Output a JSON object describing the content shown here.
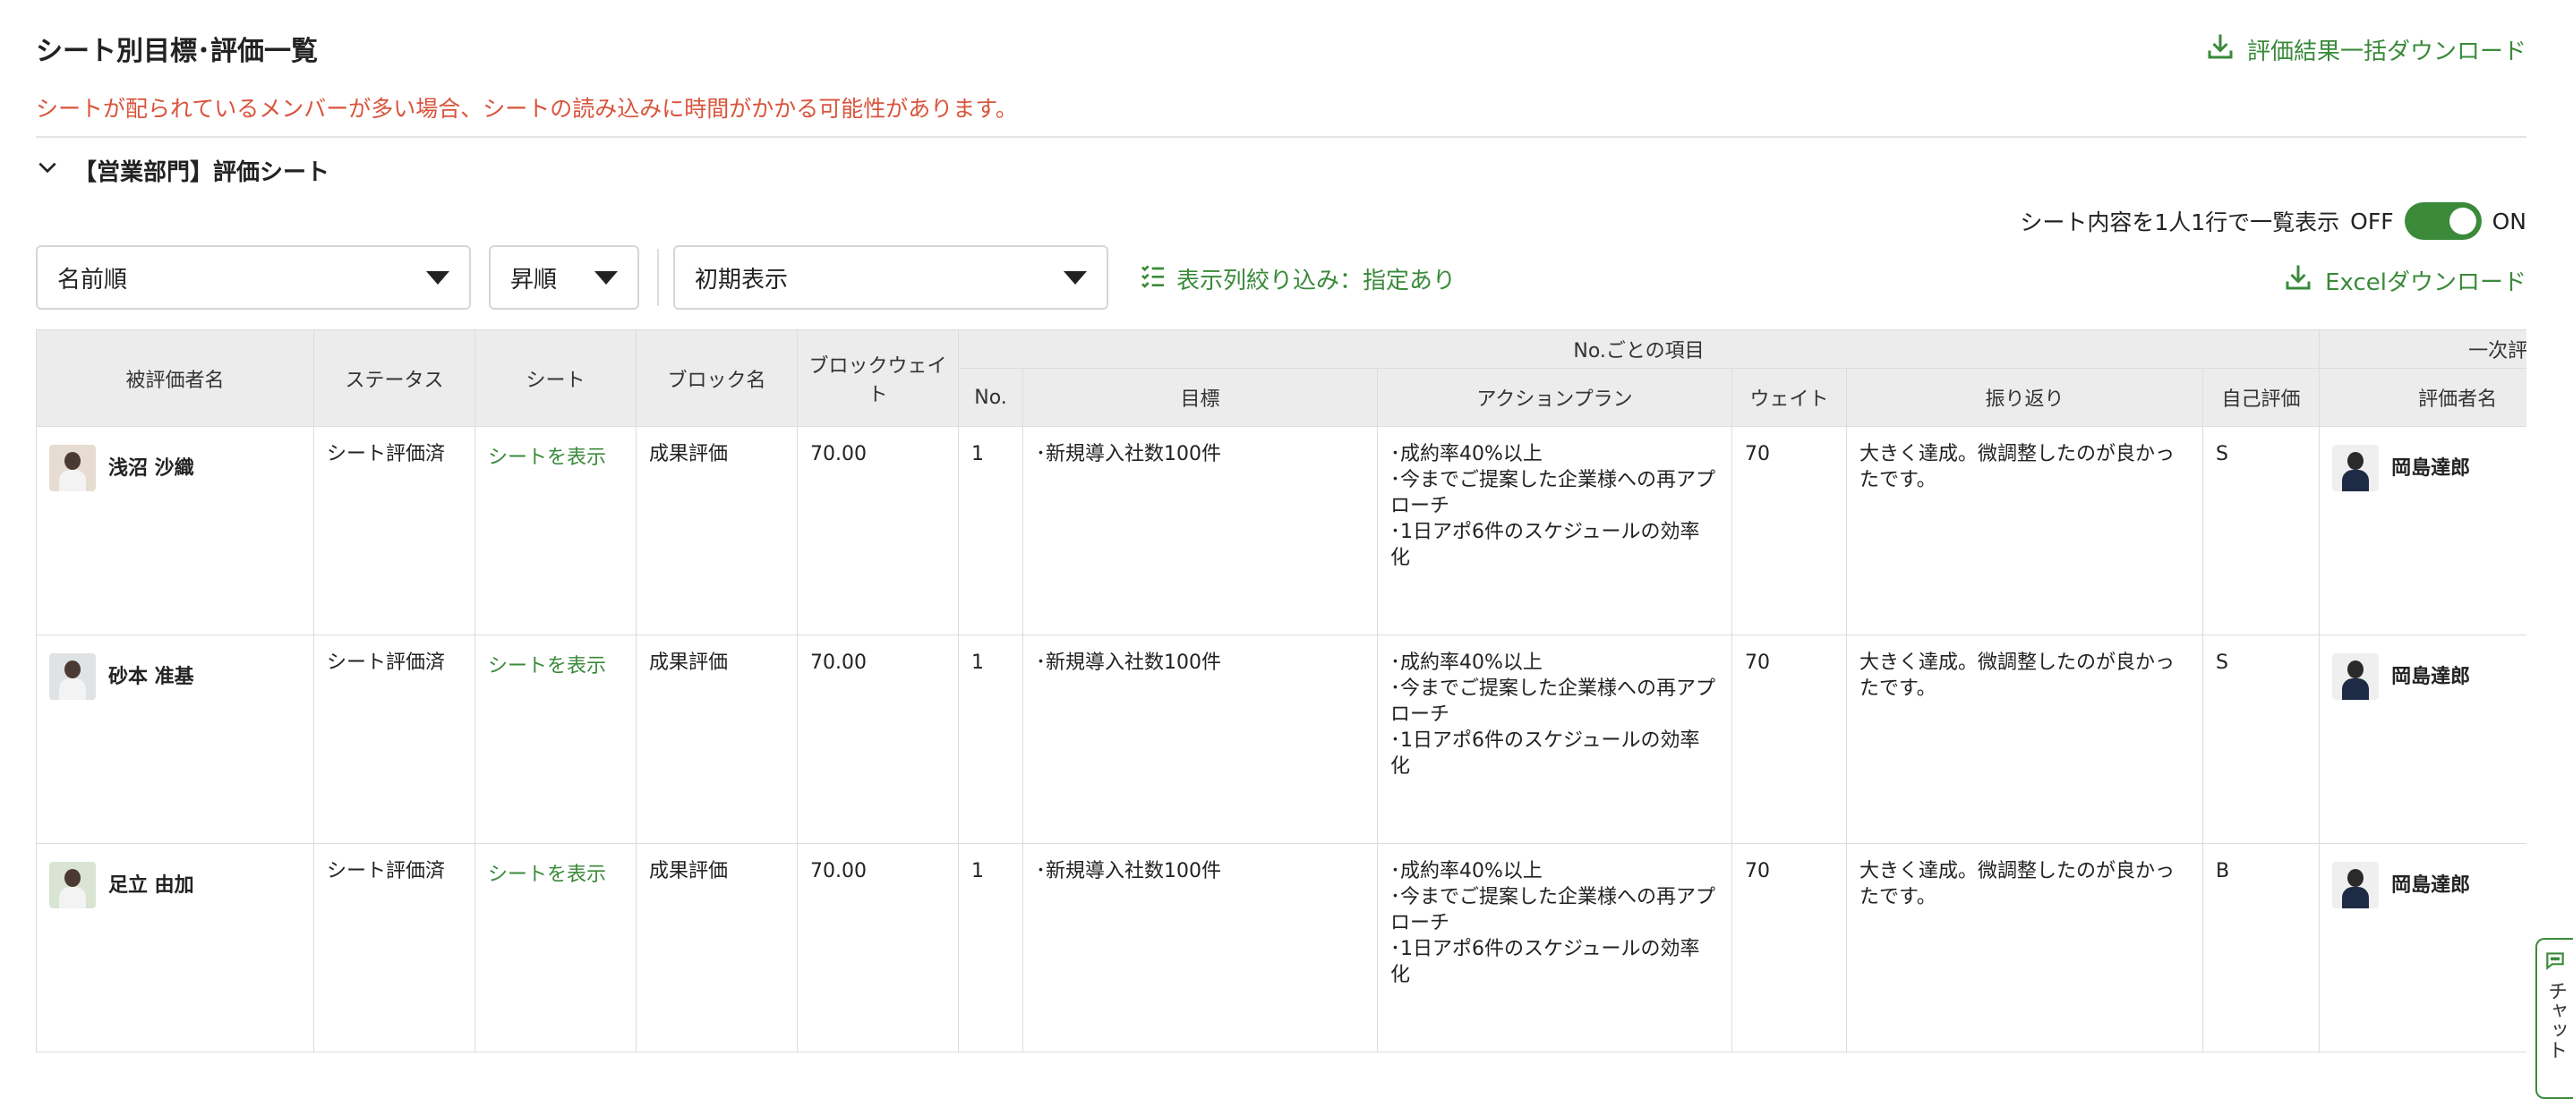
{
  "page": {
    "title": "シート別目標･評価一覧",
    "download_all": "評価結果一括ダウンロード",
    "warning": "シートが配られているメンバーが多い場合、シートの読み込みに時間がかかる可能性があります。"
  },
  "section": {
    "title": "【営業部門】評価シート"
  },
  "toggle": {
    "label": "シート内容を1人1行で一覧表示",
    "off": "OFF",
    "on": "ON",
    "state": "on"
  },
  "toolbar": {
    "sort_select": "名前順",
    "order_select": "昇順",
    "view_select": "初期表示",
    "filter_link": "表示列絞り込み：指定あり",
    "excel_download": "Excelダウンロード"
  },
  "table": {
    "headers": {
      "evaluatee": "被評価者名",
      "status": "ステータス",
      "sheet": "シート",
      "block_name": "ブロック名",
      "block_weight": "ブロックウェイト",
      "group_items": "No.ごとの項目",
      "no": "No.",
      "goal": "目標",
      "action_plan": "アクションプラン",
      "weight": "ウェイト",
      "review": "振り返り",
      "self_eval": "自己評価",
      "group_first_eval": "一次評価",
      "evaluator": "評価者名"
    },
    "rows": [
      {
        "name": "浅沼 沙織",
        "status": "シート評価済",
        "sheet_link": "シートを表示",
        "block_name": "成果評価",
        "block_weight": "70.00",
        "no": "1",
        "goal": "･新規導入社数100件",
        "action_plan_1": "･成約率40%以上",
        "action_plan_2": "･今までご提案した企業様への再アプローチ",
        "action_plan_3": "･1日アポ6件のスケジュールの効率化",
        "weight": "70",
        "review": "大きく達成。微調整したのが良かったです。",
        "self_eval": "S",
        "evaluator": "岡島達郎"
      },
      {
        "name": "砂本 准基",
        "status": "シート評価済",
        "sheet_link": "シートを表示",
        "block_name": "成果評価",
        "block_weight": "70.00",
        "no": "1",
        "goal": "･新規導入社数100件",
        "action_plan_1": "･成約率40%以上",
        "action_plan_2": "･今までご提案した企業様への再アプローチ",
        "action_plan_3": "･1日アポ6件のスケジュールの効率化",
        "weight": "70",
        "review": "大きく達成。微調整したのが良かったです。",
        "self_eval": "S",
        "evaluator": "岡島達郎"
      },
      {
        "name": "足立 由加",
        "status": "シート評価済",
        "sheet_link": "シートを表示",
        "block_name": "成果評価",
        "block_weight": "70.00",
        "no": "1",
        "goal": "･新規導入社数100件",
        "action_plan_1": "･成約率40%以上",
        "action_plan_2": "･今までご提案した企業様への再アプローチ",
        "action_plan_3": "･1日アポ6件のスケジュールの効率化",
        "weight": "70",
        "review": "大きく達成。微調整したのが良かったです。",
        "self_eval": "B",
        "evaluator": "岡島達郎"
      }
    ]
  },
  "chat": {
    "label": "チャット"
  },
  "colors": {
    "accent": "#3a8a3a",
    "warning": "#d9543c"
  },
  "icons": {
    "download": "download-icon",
    "chevron": "chevron-down-icon",
    "filter": "checklist-icon",
    "chat": "chat-bubble-icon"
  }
}
